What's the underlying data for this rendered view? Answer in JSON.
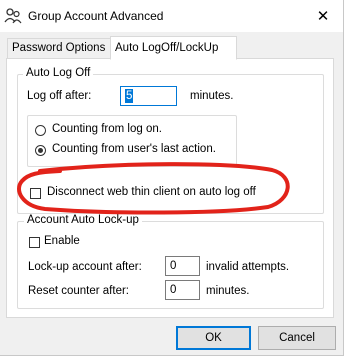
{
  "window": {
    "title": "Group Account Advanced",
    "title_icon": "group-users-icon",
    "close_glyph": "✕"
  },
  "tabs": [
    {
      "label": "Password Options",
      "active": false
    },
    {
      "label": "Auto LogOff/LockUp",
      "active": true
    }
  ],
  "auto_log_off": {
    "group_title": "Auto Log Off",
    "log_off_label": "Log off after:",
    "log_off_value": "5",
    "log_off_unit": "minutes.",
    "radio_from_logon": "Counting from log on.",
    "radio_from_last_action": "Counting from user's last action.",
    "selected_radio": "from_last_action",
    "disconnect_label": "Disconnect web thin client on auto log off",
    "disconnect_checked": false
  },
  "account_lockup": {
    "group_title": "Account Auto Lock-up",
    "enable_label": "Enable",
    "enable_checked": false,
    "lockup_label": "Lock-up account after:",
    "lockup_value": "0",
    "lockup_unit": "invalid attempts.",
    "reset_label": "Reset counter after:",
    "reset_value": "0",
    "reset_unit": "minutes."
  },
  "buttons": {
    "ok": "OK",
    "cancel": "Cancel"
  },
  "colors": {
    "accent": "#0078d7",
    "annotation": "#e2231a"
  }
}
